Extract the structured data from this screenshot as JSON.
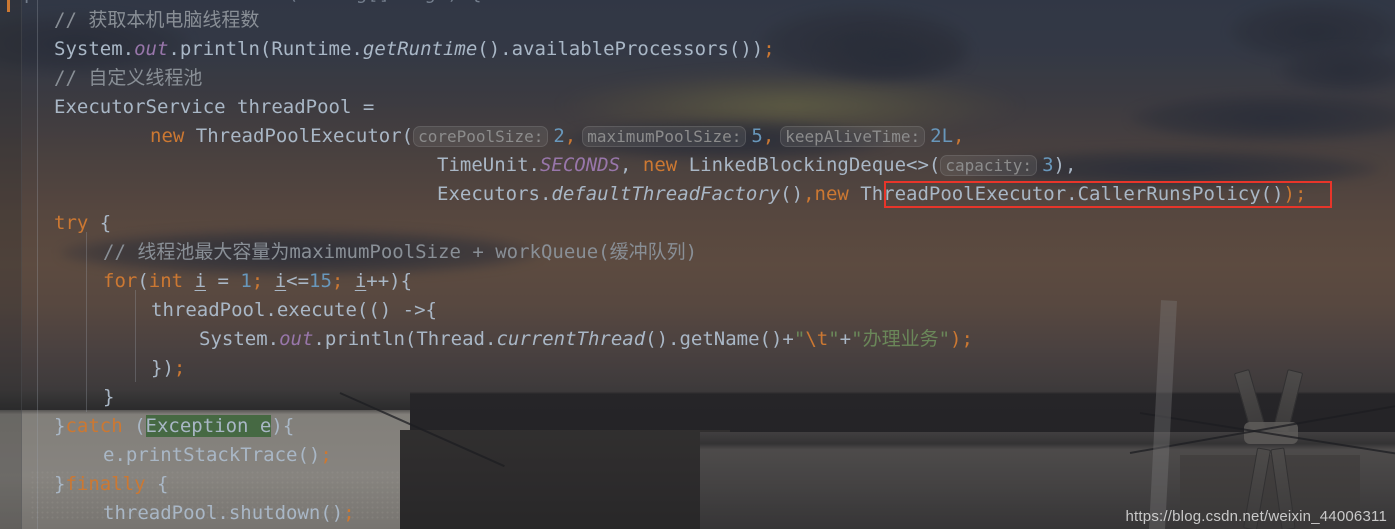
{
  "app": {
    "name": "IntelliJ IDEA Java Editor",
    "language": "Java",
    "theme": "Darcula with background image"
  },
  "watermark": {
    "text": "https://blog.csdn.net/weixin_44006311"
  },
  "annotation": {
    "type": "red-rectangle",
    "color": "#e8352a",
    "target_text": "ThreadPoolExecutor.CallerRunsPolicy()"
  },
  "colors": {
    "keyword": "#cc7832",
    "identifier": "#a9b7c6",
    "comment": "#898f96",
    "number": "#6897bb",
    "string": "#6a8759",
    "static_field": "#9876aa",
    "hint_text": "#8c8c8c",
    "annotation": "#e8352a",
    "highlight_green": "#326230"
  },
  "code": {
    "partial_top_line": "public static void main(String[] args) {",
    "lines": [
      {
        "n": 1,
        "indent": 2,
        "text": "// 获取本机电脑线程数",
        "tokens": [
          {
            "t": "// 获取本机电脑线程数",
            "c": "cmt"
          }
        ]
      },
      {
        "n": 2,
        "indent": 2,
        "text": "System.out.println(Runtime.getRuntime().availableProcessors());",
        "tokens": [
          {
            "t": "System.",
            "c": "plain"
          },
          {
            "t": "out",
            "c": "stat"
          },
          {
            "t": ".println(Runtime.",
            "c": "plain"
          },
          {
            "t": "getRuntime",
            "c": "meth"
          },
          {
            "t": "().availableProcessors())",
            "c": "plain"
          },
          {
            "t": ";",
            "c": "semi"
          }
        ]
      },
      {
        "n": 3,
        "indent": 2,
        "text": "// 自定义线程池",
        "tokens": [
          {
            "t": "// 自定义线程池",
            "c": "cmt"
          }
        ]
      },
      {
        "n": 4,
        "indent": 2,
        "text": "ExecutorService threadPool =",
        "tokens": [
          {
            "t": "ExecutorService threadPool =",
            "c": "plain"
          }
        ]
      },
      {
        "n": 5,
        "indent": 6,
        "text": "new ThreadPoolExecutor( corePoolSize: 2, maximumPoolSize: 5, keepAliveTime: 2L,",
        "tokens": [
          {
            "t": "new",
            "c": "kw"
          },
          {
            "t": " ThreadPoolExecutor(",
            "c": "plain"
          },
          {
            "t": "corePoolSize:",
            "c": "hint"
          },
          {
            "t": "2",
            "c": "num"
          },
          {
            "t": ",",
            "c": "semi"
          },
          {
            "t": "maximumPoolSize:",
            "c": "hint"
          },
          {
            "t": "5",
            "c": "num"
          },
          {
            "t": ",",
            "c": "semi"
          },
          {
            "t": "keepAliveTime:",
            "c": "hint"
          },
          {
            "t": "2L",
            "c": "num"
          },
          {
            "t": ",",
            "c": "semi"
          }
        ]
      },
      {
        "n": 6,
        "indent": 15,
        "text": "TimeUnit.SECONDS, new LinkedBlockingDeque<>( capacity: 3),",
        "tokens": [
          {
            "t": "TimeUnit.",
            "c": "plain"
          },
          {
            "t": "SECONDS",
            "c": "stat"
          },
          {
            "t": ", ",
            "c": "semi"
          },
          {
            "t": "new",
            "c": "kw"
          },
          {
            "t": " LinkedBlockingDeque<>(",
            "c": "plain"
          },
          {
            "t": "capacity:",
            "c": "hint"
          },
          {
            "t": "3",
            "c": "num"
          },
          {
            "t": "),",
            "c": "semi"
          }
        ]
      },
      {
        "n": 7,
        "indent": 15,
        "text": "Executors.defaultThreadFactory(),new ThreadPoolExecutor.CallerRunsPolicy());",
        "tokens": [
          {
            "t": "Executors.",
            "c": "plain"
          },
          {
            "t": "defaultThreadFactory",
            "c": "meth"
          },
          {
            "t": "()",
            "c": "plain"
          },
          {
            "t": ",",
            "c": "semi"
          },
          {
            "t": "new",
            "c": "kw"
          },
          {
            "t": " ThreadPoolExecutor.CallerRunsPolicy()",
            "c": "plain"
          },
          {
            "t": ");",
            "c": "semi"
          }
        ]
      },
      {
        "n": 8,
        "indent": 0,
        "text": "",
        "tokens": []
      },
      {
        "n": 9,
        "indent": 2,
        "text": "try {",
        "tokens": [
          {
            "t": "try",
            "c": "kw"
          },
          {
            "t": " {",
            "c": "plain"
          }
        ]
      },
      {
        "n": 10,
        "indent": 4,
        "text": "// 线程池最大容量为maximumPoolSize + workQueue(缓冲队列)",
        "tokens": [
          {
            "t": "// 线程池最大容量为maximumPoolSize + workQueue(缓冲队列)",
            "c": "cmt"
          }
        ]
      },
      {
        "n": 11,
        "indent": 4,
        "text": "for(int i = 1; i<=15; i++){",
        "tokens": [
          {
            "t": "for",
            "c": "kw"
          },
          {
            "t": "(",
            "c": "plain"
          },
          {
            "t": "int",
            "c": "kw"
          },
          {
            "t": " ",
            "c": "plain"
          },
          {
            "t": "i",
            "c": "local"
          },
          {
            "t": " = ",
            "c": "plain"
          },
          {
            "t": "1",
            "c": "num"
          },
          {
            "t": "; ",
            "c": "semi"
          },
          {
            "t": "i",
            "c": "local"
          },
          {
            "t": "<=",
            "c": "plain"
          },
          {
            "t": "15",
            "c": "num"
          },
          {
            "t": "; ",
            "c": "semi"
          },
          {
            "t": "i",
            "c": "local"
          },
          {
            "t": "++){",
            "c": "plain"
          }
        ]
      },
      {
        "n": 12,
        "indent": 6,
        "text": "threadPool.execute(() ->{",
        "tokens": [
          {
            "t": "threadPool.execute(() ->{",
            "c": "plain"
          }
        ]
      },
      {
        "n": 13,
        "indent": 8,
        "text": "System.out.println(Thread.currentThread().getName()+\"\\t\"+\"办理业务\");",
        "tokens": [
          {
            "t": "System.",
            "c": "plain"
          },
          {
            "t": "out",
            "c": "stat"
          },
          {
            "t": ".println(Thread.",
            "c": "plain"
          },
          {
            "t": "currentThread",
            "c": "meth"
          },
          {
            "t": "().getName()+",
            "c": "plain"
          },
          {
            "t": "\"",
            "c": "str"
          },
          {
            "t": "\\t",
            "c": "esc"
          },
          {
            "t": "\"",
            "c": "str"
          },
          {
            "t": "+",
            "c": "plain"
          },
          {
            "t": "\"办理业务\"",
            "c": "str"
          },
          {
            "t": ");",
            "c": "semi"
          }
        ]
      },
      {
        "n": 14,
        "indent": 6,
        "text": "});",
        "tokens": [
          {
            "t": "})",
            "c": "plain"
          },
          {
            "t": ";",
            "c": "semi"
          }
        ]
      },
      {
        "n": 15,
        "indent": 4,
        "text": "}",
        "tokens": [
          {
            "t": "}",
            "c": "plain"
          }
        ]
      },
      {
        "n": 16,
        "indent": 2,
        "text": "}catch (Exception e){",
        "tokens": [
          {
            "t": "}",
            "c": "plain"
          },
          {
            "t": "catch",
            "c": "kw"
          },
          {
            "t": " (",
            "c": "plain"
          },
          {
            "t": "Exception e",
            "c": "plain"
          },
          {
            "t": "){",
            "c": "plain"
          }
        ]
      },
      {
        "n": 17,
        "indent": 4,
        "text": "e.printStackTrace();",
        "tokens": [
          {
            "t": "e.printStackTrace()",
            "c": "plain"
          },
          {
            "t": ";",
            "c": "semi"
          }
        ]
      },
      {
        "n": 18,
        "indent": 2,
        "text": "}finally {",
        "tokens": [
          {
            "t": "}",
            "c": "plain"
          },
          {
            "t": "finally",
            "c": "kw"
          },
          {
            "t": " {",
            "c": "plain"
          }
        ]
      },
      {
        "n": 19,
        "indent": 4,
        "text": "threadPool.shutdown();",
        "tokens": [
          {
            "t": "threadPool.shutdown()",
            "c": "plain"
          },
          {
            "t": ";",
            "c": "semi"
          }
        ]
      }
    ]
  }
}
